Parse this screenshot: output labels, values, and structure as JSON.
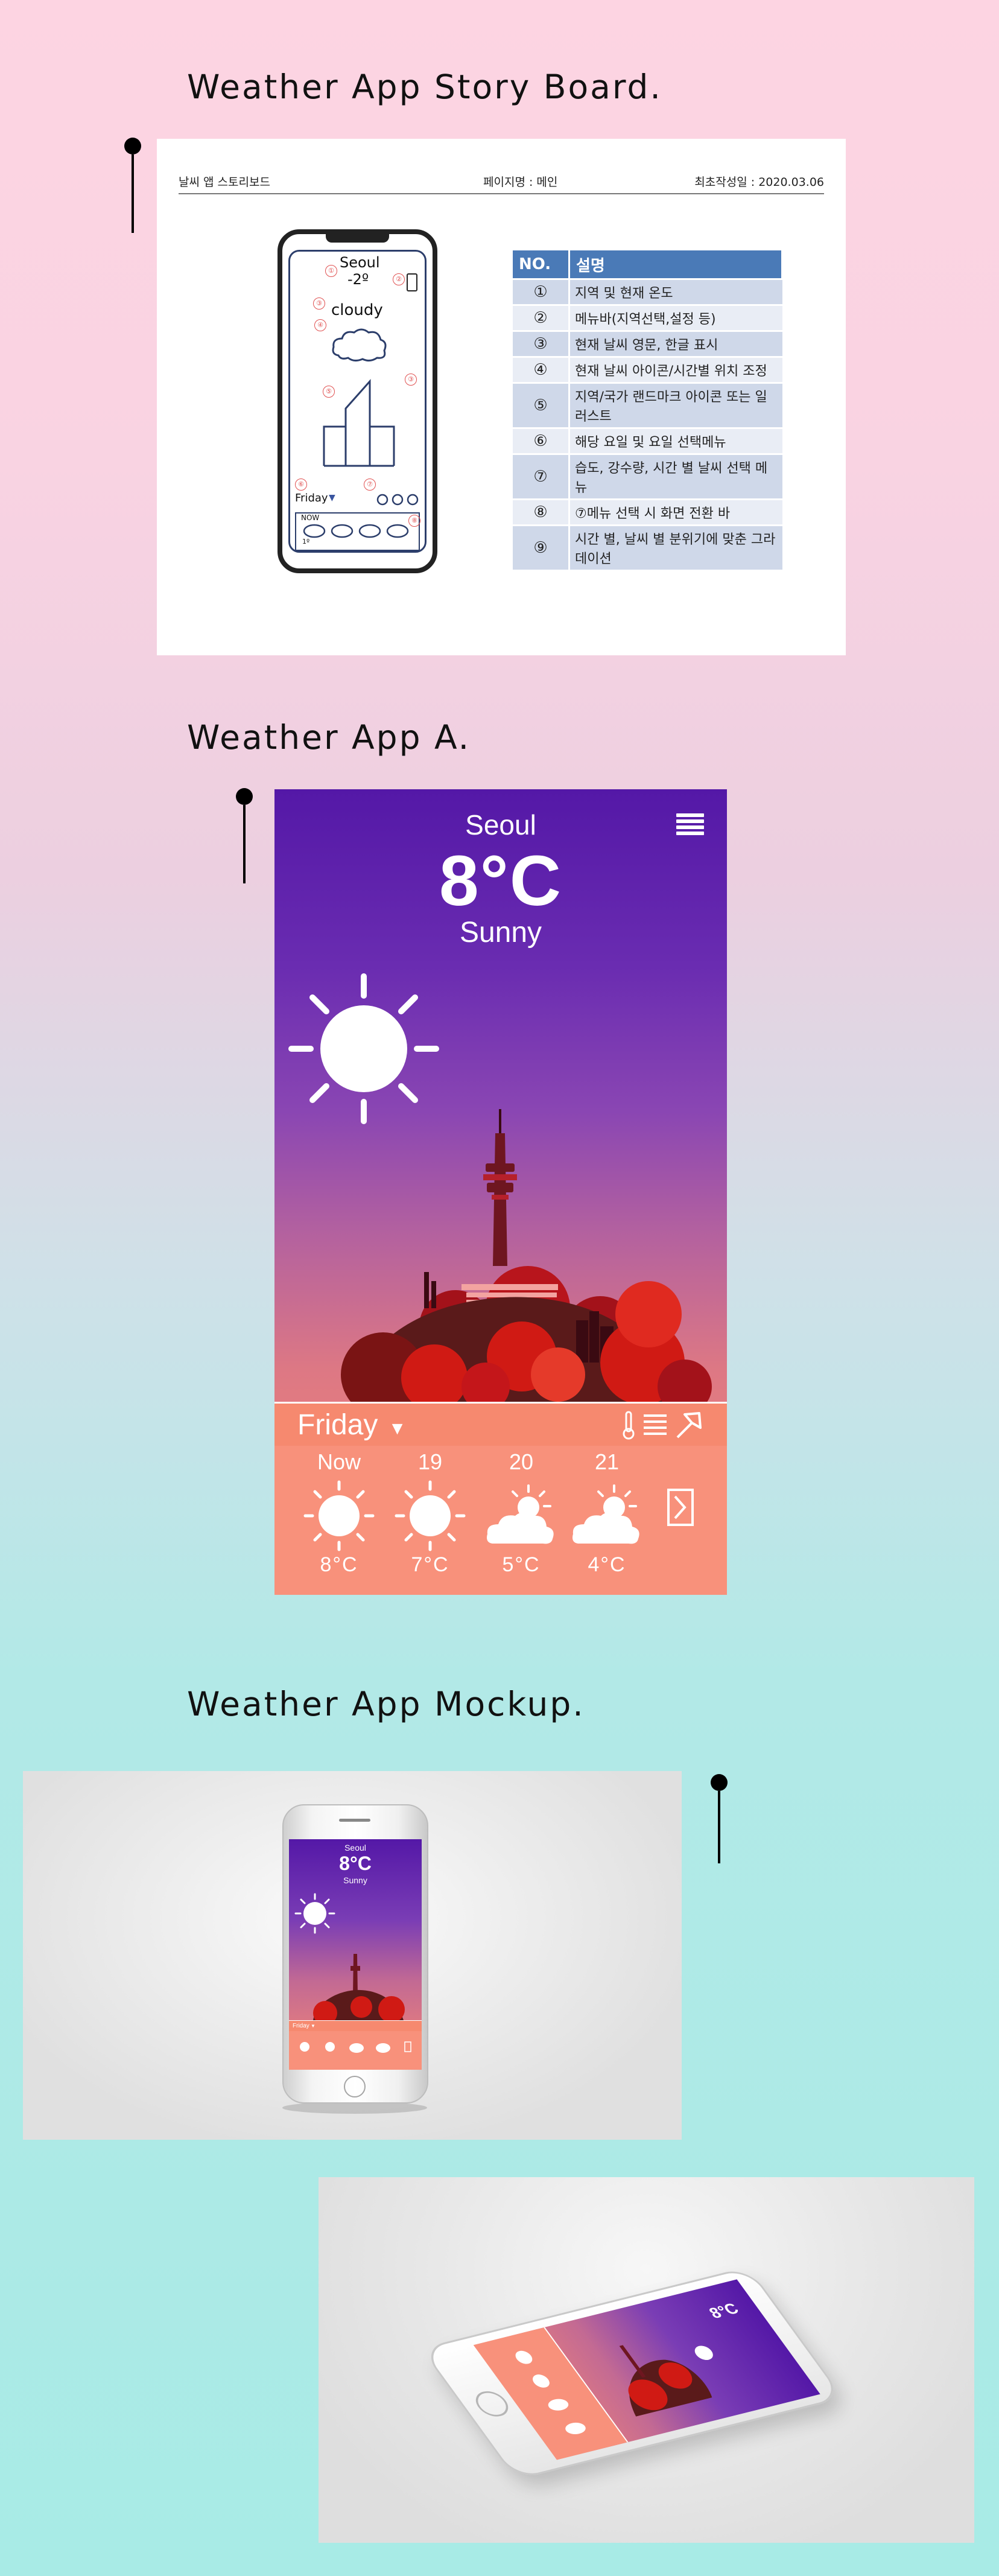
{
  "sections": {
    "storyboard_title": "Weather App Story Board.",
    "app_a_title": "Weather App A.",
    "mockup_title": "Weather App Mockup."
  },
  "storyboard": {
    "header": {
      "left": "날씨 앱 스토리보드",
      "center": "페이지명 : 메인",
      "right": "최초작성일 : 2020.03.06"
    },
    "sketch": {
      "city": "Seoul",
      "temp": "-2º",
      "condition": "cloudy",
      "day": "Friday",
      "now": "NOW",
      "temp_small": "1º",
      "markers": [
        "①",
        "②",
        "③",
        "④",
        "⑤",
        "③",
        "⑥",
        "⑦",
        "⑧"
      ]
    },
    "table": {
      "headers": [
        "NO.",
        "설명"
      ],
      "rows": [
        {
          "no": "①",
          "desc": "지역 및 현재 온도"
        },
        {
          "no": "②",
          "desc": "메뉴바(지역선택,설정 등)"
        },
        {
          "no": "③",
          "desc": "현재 날씨 영문, 한글 표시"
        },
        {
          "no": "④",
          "desc": "현재 날씨 아이콘/시간별 위치 조정"
        },
        {
          "no": "⑤",
          "desc": "지역/국가 랜드마크 아이콘 또는 일러스트"
        },
        {
          "no": "⑥",
          "desc": "해당 요일 및 요일 선택메뉴"
        },
        {
          "no": "⑦",
          "desc": "습도, 강수량, 시간 별 날씨 선택 메뉴"
        },
        {
          "no": "⑧",
          "desc": "⑦메뉴 선택 시 화면 전환 바"
        },
        {
          "no": "⑨",
          "desc": "시간 별, 날씨 별 분위기에 맞춘 그라데이션"
        }
      ]
    }
  },
  "app": {
    "city": "Seoul",
    "temperature": "8°C",
    "condition": "Sunny",
    "day": "Friday",
    "forecast": [
      {
        "label": "Now",
        "icon": "sun-icon",
        "temp": "8°C"
      },
      {
        "label": "19",
        "icon": "sun-icon",
        "temp": "7°C"
      },
      {
        "label": "20",
        "icon": "cloud-sun-icon",
        "temp": "5°C"
      },
      {
        "label": "21",
        "icon": "cloud-sun-icon",
        "temp": "4°C"
      }
    ],
    "colors": {
      "sky_top": "#5418a7",
      "sky_bottom": "#f88872",
      "forecast_bg": "#f8917b",
      "hill_dark": "#5a1a1a",
      "hill_red": "#d01a14"
    }
  },
  "mockup": {
    "city": "Seoul",
    "temperature": "8°C",
    "condition": "Sunny",
    "day": "Friday"
  }
}
